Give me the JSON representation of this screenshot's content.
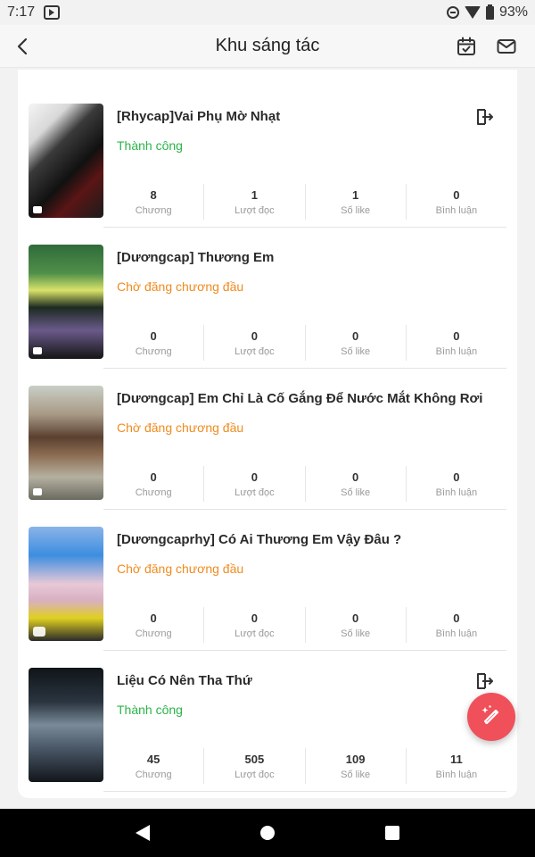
{
  "status_bar": {
    "time": "7:17",
    "battery": "93%"
  },
  "header": {
    "title": "Khu sáng tác",
    "icons": [
      "back-arrow-icon",
      "calendar-check-icon",
      "mail-icon"
    ]
  },
  "colors": {
    "success": "#2bb44a",
    "pending": "#f08b1e",
    "fab": "#f0505a"
  },
  "stat_labels": [
    "Chương",
    "Lượt đọc",
    "Số like",
    "Bình luận"
  ],
  "stories": [
    {
      "title": "[Rhycap]Vai Phụ Mờ Nhạt",
      "status": "Thành công",
      "status_type": "success",
      "has_exit": true,
      "stats": [
        "8",
        "1",
        "1",
        "0"
      ]
    },
    {
      "title": "[Dươngcap] Thương Em",
      "status": "Chờ đăng chương đầu",
      "status_type": "pending",
      "has_exit": false,
      "stats": [
        "0",
        "0",
        "0",
        "0"
      ]
    },
    {
      "title": "[Dươngcap] Em Chỉ Là Cố Gắng Để Nước Mắt Không Rơi",
      "status": "Chờ đăng chương đầu",
      "status_type": "pending",
      "has_exit": false,
      "stats": [
        "0",
        "0",
        "0",
        "0"
      ]
    },
    {
      "title": "[Dươngcaprhy] Có Ai Thương Em Vậy Đâu ?",
      "status": "Chờ đăng chương đầu",
      "status_type": "pending",
      "has_exit": false,
      "stats": [
        "0",
        "0",
        "0",
        "0"
      ]
    },
    {
      "title": "Liệu Có Nên Tha Thứ",
      "status": "Thành công",
      "status_type": "success",
      "has_exit": true,
      "stats": [
        "45",
        "505",
        "109",
        "11"
      ]
    }
  ]
}
